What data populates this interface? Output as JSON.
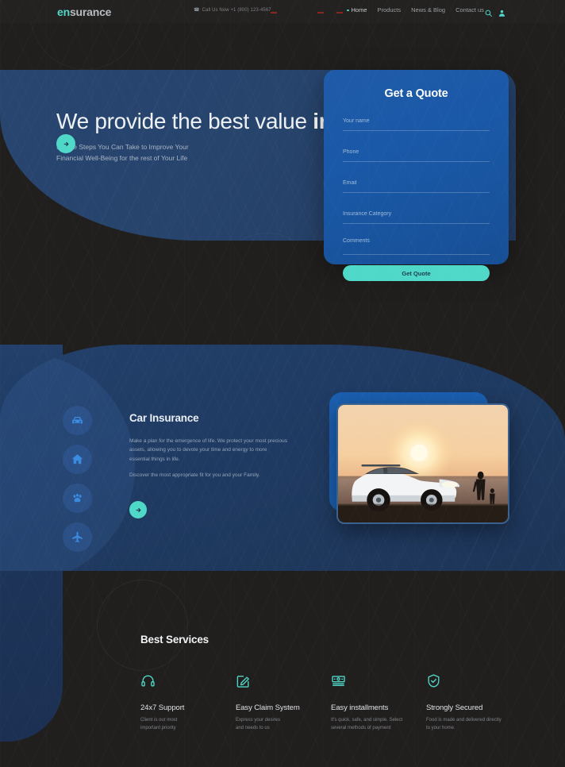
{
  "header": {
    "logo_en": "en",
    "logo_surance": "surance",
    "phone_icon": "phone-icon",
    "phone_text": "Call Us Now +1 (800) 123-4567",
    "nav": [
      {
        "label": "Home",
        "active": true
      },
      {
        "label": "Products",
        "active": false
      },
      {
        "label": "News & Blog",
        "active": false
      },
      {
        "label": "Contact us",
        "active": false
      }
    ],
    "search_icon": "search-icon",
    "user_icon": "user-account-icon"
  },
  "hero": {
    "heading_light": "We provide the best value ",
    "heading_bold": "insurance",
    "sub_line1": "Simple Steps You Can Take to Improve Your",
    "sub_line2": "Financial Well-Being for the rest of Your Life",
    "cta_icon": "arrow-right-icon"
  },
  "quote": {
    "title": "Get a Quote",
    "fields": [
      {
        "name": "your-name",
        "placeholder": "Your name",
        "value": ""
      },
      {
        "name": "phone",
        "placeholder": "Phone",
        "value": ""
      },
      {
        "name": "email",
        "placeholder": "Email",
        "value": ""
      },
      {
        "name": "insurance-category",
        "placeholder": "Insurance Category",
        "value": ""
      },
      {
        "name": "comments",
        "placeholder": "Comments",
        "value": ""
      }
    ],
    "submit_label": "Get Quote"
  },
  "insurance": {
    "sidenav": [
      {
        "icon": "car-icon",
        "label": "Car Insurance",
        "active": true
      },
      {
        "icon": "home-icon",
        "label": "Home Insurance",
        "active": false
      },
      {
        "icon": "pet-paw-icon",
        "label": "Pet Insurance",
        "active": false
      },
      {
        "icon": "airplane-icon",
        "label": "Travel Insurance",
        "active": false
      }
    ],
    "title": "Car Insurance",
    "paragraph1": "Make a plan for the emergence of life. We protect your most precious assets, allowing you to devote your time and energy to more essential things in life.",
    "paragraph2": "Discover the most appropriate fit for you and your Family.",
    "cta_icon": "arrow-right-icon",
    "photo_alt": "white SUV parked at lakeside at sunset with family silhouettes"
  },
  "services": {
    "title": "Best Services",
    "items": [
      {
        "icon": "headset-icon",
        "title": "24x7 Support",
        "desc_line1": "Client is our most",
        "desc_line2": "important priority"
      },
      {
        "icon": "edit-document-icon",
        "title": "Easy Claim System",
        "desc_line1": "Express your desires",
        "desc_line2": "and needs to us"
      },
      {
        "icon": "banknote-icon",
        "title": "Easy installments",
        "desc_line1": "It's quick, safe, and simple. Select",
        "desc_line2": "several methods of payment"
      },
      {
        "icon": "shield-check-icon",
        "title": "Strongly Secured",
        "desc_line1": "Food is made and delivered directly",
        "desc_line2": "to your home."
      }
    ]
  },
  "colors": {
    "accent_teal": "#4fd8c8",
    "brand_blue": "#1f5aa8",
    "hero_blue": "#27456f",
    "dark_bg": "#211f1e",
    "icon_blue": "#3a8ae0"
  }
}
